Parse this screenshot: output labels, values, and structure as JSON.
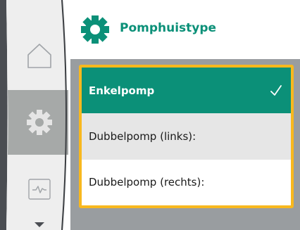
{
  "header": {
    "title": "Pomphuistype",
    "icon": "gear-icon",
    "title_color": "#0b9078"
  },
  "sidebar": {
    "items": [
      {
        "icon": "home-icon",
        "active": false
      },
      {
        "icon": "gear-icon",
        "active": true
      },
      {
        "icon": "pulse-monitor-icon",
        "active": false
      }
    ],
    "more_icon": "chevron-down-icon"
  },
  "options": [
    {
      "label": "Enkelpomp",
      "selected": true
    },
    {
      "label": "Dubbelpomp (links):",
      "selected": false
    },
    {
      "label": "Dubbelpomp (rechts):",
      "selected": false
    }
  ],
  "colors": {
    "accent": "#0b9078",
    "focus_border": "#f8b81e",
    "content_background": "#999da0",
    "rail_active": "#a6a9a8"
  }
}
